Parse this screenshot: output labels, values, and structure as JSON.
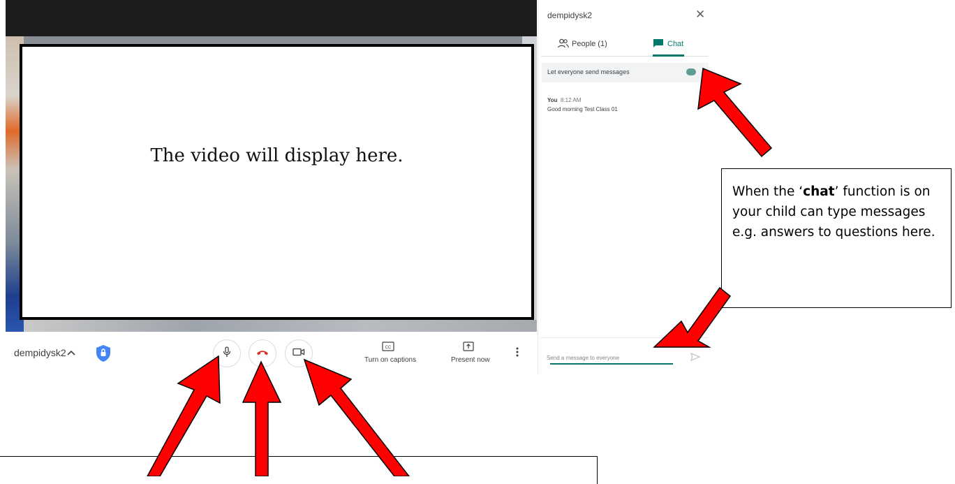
{
  "video": {
    "placeholder_text": "The video will display here."
  },
  "bottom_bar": {
    "meeting_name": "dempidysk2",
    "captions_label": "Turn on captions",
    "present_label": "Present now",
    "icons": [
      "chevron-up-icon",
      "shield-icon",
      "microphone-icon",
      "hang-up-icon",
      "camera-icon",
      "captions-icon",
      "present-icon",
      "more-vert-icon"
    ]
  },
  "side_panel": {
    "title": "dempidysk2",
    "close_glyph": "✕",
    "tabs": [
      {
        "label": "People (1)"
      },
      {
        "label": "Chat",
        "active": true
      }
    ],
    "setting_label": "Let everyone send messages",
    "setting_on": true,
    "messages": [
      {
        "sender": "You",
        "time": "8:12 AM",
        "text": "Good morning Test Class 01"
      }
    ],
    "input_placeholder": "Send a message to everyone"
  },
  "callout": {
    "prefix": "When the ‘",
    "bold": "chat",
    "suffix": "’ function is on your child can type messages e.g. answers to questions here."
  },
  "colors": {
    "accent": "#00796b",
    "arrow": "#ff0000",
    "hangup": "#d93025",
    "shield": "#4285f4"
  }
}
